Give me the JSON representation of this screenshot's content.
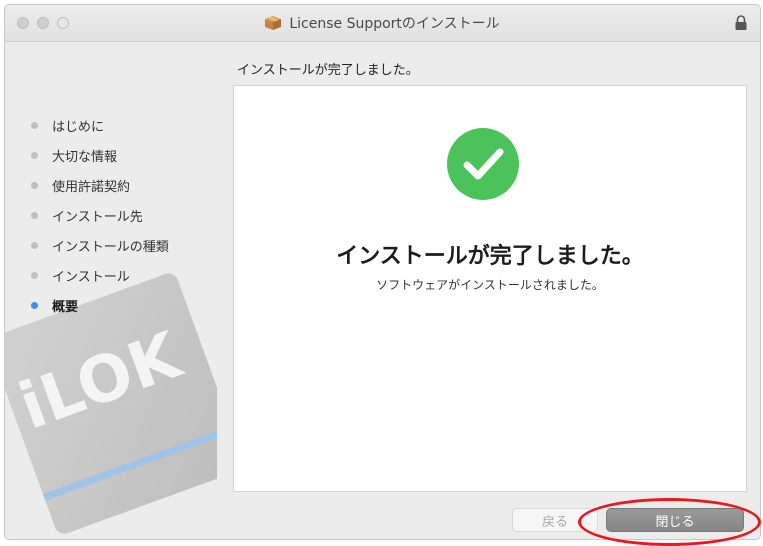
{
  "window": {
    "title": "License Supportのインストール"
  },
  "sidebar": {
    "logo_text": "iLOK",
    "steps": [
      {
        "label": "はじめに",
        "active": false
      },
      {
        "label": "大切な情報",
        "active": false
      },
      {
        "label": "使用許諾契約",
        "active": false
      },
      {
        "label": "インストール先",
        "active": false
      },
      {
        "label": "インストールの種類",
        "active": false
      },
      {
        "label": "インストール",
        "active": false
      },
      {
        "label": "概要",
        "active": true
      }
    ]
  },
  "main": {
    "heading": "インストールが完了しました。",
    "big_title": "インストールが完了しました。",
    "sub_text": "ソフトウェアがインストールされました。"
  },
  "buttons": {
    "back_label": "戻る",
    "close_label": "閉じる"
  },
  "icons": {
    "package": "package-icon",
    "lock": "lock-icon",
    "success": "checkmark-circle-icon"
  },
  "colors": {
    "success_green": "#4cc35a",
    "active_step": "#3c8ff5",
    "highlight_red": "#e8181e"
  }
}
